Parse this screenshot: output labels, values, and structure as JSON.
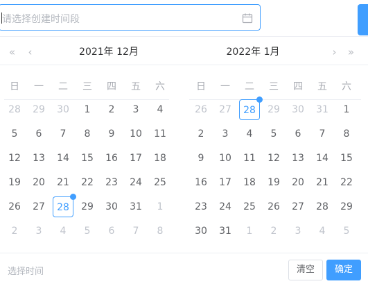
{
  "input": {
    "placeholder": "请选择创建时间段",
    "icon": "calendar-icon"
  },
  "left": {
    "title": "2021年 12月",
    "nav": [
      "«",
      "‹"
    ],
    "weekdays": [
      "日",
      "一",
      "二",
      "三",
      "四",
      "五",
      "六"
    ],
    "days": [
      {
        "t": "28",
        "o": true
      },
      {
        "t": "29",
        "o": true
      },
      {
        "t": "30",
        "o": true
      },
      {
        "t": "1",
        "o": false
      },
      {
        "t": "2",
        "o": false
      },
      {
        "t": "3",
        "o": false
      },
      {
        "t": "4",
        "o": false
      },
      {
        "t": "5",
        "o": false
      },
      {
        "t": "6",
        "o": false
      },
      {
        "t": "7",
        "o": false
      },
      {
        "t": "8",
        "o": false
      },
      {
        "t": "9",
        "o": false
      },
      {
        "t": "10",
        "o": false
      },
      {
        "t": "11",
        "o": false
      },
      {
        "t": "12",
        "o": false
      },
      {
        "t": "13",
        "o": false
      },
      {
        "t": "14",
        "o": false
      },
      {
        "t": "15",
        "o": false
      },
      {
        "t": "16",
        "o": false
      },
      {
        "t": "17",
        "o": false
      },
      {
        "t": "18",
        "o": false
      },
      {
        "t": "19",
        "o": false
      },
      {
        "t": "20",
        "o": false
      },
      {
        "t": "21",
        "o": false
      },
      {
        "t": "22",
        "o": false
      },
      {
        "t": "23",
        "o": false
      },
      {
        "t": "24",
        "o": false
      },
      {
        "t": "25",
        "o": false
      },
      {
        "t": "26",
        "o": false
      },
      {
        "t": "27",
        "o": false
      },
      {
        "t": "28",
        "o": false,
        "today": true
      },
      {
        "t": "29",
        "o": false
      },
      {
        "t": "30",
        "o": false
      },
      {
        "t": "31",
        "o": false
      },
      {
        "t": "1",
        "o": true
      },
      {
        "t": "2",
        "o": true
      },
      {
        "t": "3",
        "o": true
      },
      {
        "t": "4",
        "o": true
      },
      {
        "t": "5",
        "o": true
      },
      {
        "t": "6",
        "o": true
      },
      {
        "t": "7",
        "o": true
      },
      {
        "t": "8",
        "o": true
      }
    ]
  },
  "right": {
    "title": "2022年 1月",
    "nav": [
      "›",
      "»"
    ],
    "weekdays": [
      "日",
      "一",
      "二",
      "三",
      "四",
      "五",
      "六"
    ],
    "days": [
      {
        "t": "26",
        "o": true
      },
      {
        "t": "27",
        "o": true
      },
      {
        "t": "28",
        "o": false,
        "today": true
      },
      {
        "t": "29",
        "o": true
      },
      {
        "t": "30",
        "o": true
      },
      {
        "t": "31",
        "o": true
      },
      {
        "t": "1",
        "o": false
      },
      {
        "t": "2",
        "o": false
      },
      {
        "t": "3",
        "o": false
      },
      {
        "t": "4",
        "o": false
      },
      {
        "t": "5",
        "o": false
      },
      {
        "t": "6",
        "o": false
      },
      {
        "t": "7",
        "o": false
      },
      {
        "t": "8",
        "o": false
      },
      {
        "t": "9",
        "o": false
      },
      {
        "t": "10",
        "o": false
      },
      {
        "t": "11",
        "o": false
      },
      {
        "t": "12",
        "o": false
      },
      {
        "t": "13",
        "o": false
      },
      {
        "t": "14",
        "o": false
      },
      {
        "t": "15",
        "o": false
      },
      {
        "t": "16",
        "o": false
      },
      {
        "t": "17",
        "o": false
      },
      {
        "t": "18",
        "o": false
      },
      {
        "t": "19",
        "o": false
      },
      {
        "t": "20",
        "o": false
      },
      {
        "t": "21",
        "o": false
      },
      {
        "t": "22",
        "o": false
      },
      {
        "t": "23",
        "o": false
      },
      {
        "t": "24",
        "o": false
      },
      {
        "t": "25",
        "o": false
      },
      {
        "t": "26",
        "o": false
      },
      {
        "t": "27",
        "o": false
      },
      {
        "t": "28",
        "o": false
      },
      {
        "t": "29",
        "o": false
      },
      {
        "t": "30",
        "o": false
      },
      {
        "t": "31",
        "o": false
      },
      {
        "t": "1",
        "o": true
      },
      {
        "t": "2",
        "o": true
      },
      {
        "t": "3",
        "o": true
      },
      {
        "t": "4",
        "o": true
      },
      {
        "t": "5",
        "o": true
      }
    ]
  },
  "footer": {
    "time_select": "选择时间",
    "clear_label": "清空",
    "ok_label": "确定"
  },
  "colors": {
    "accent": "#409eff",
    "text": "#606266",
    "muted": "#c0c4cc"
  }
}
